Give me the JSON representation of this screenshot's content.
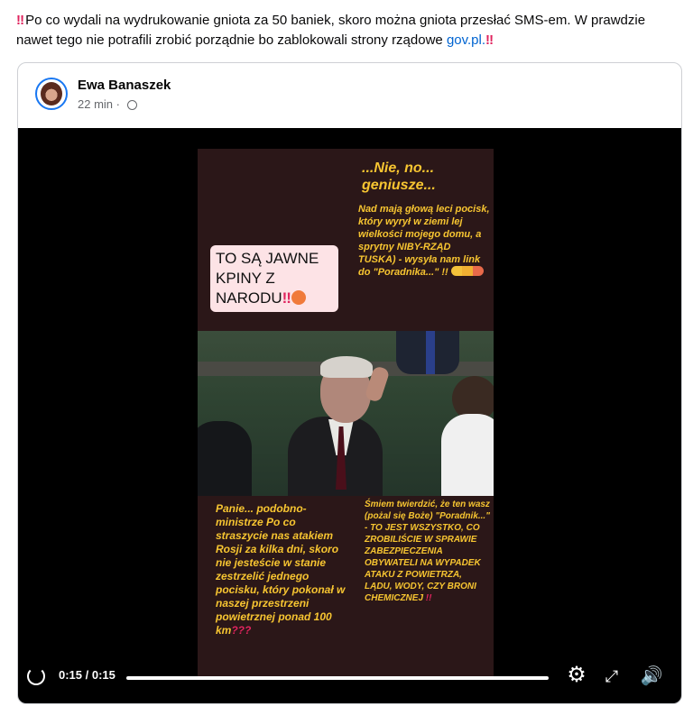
{
  "post": {
    "bang": "‼",
    "text_main": "Po co wydali na wydrukowanie gniota za 50 baniek, skoro można gniota przesłać SMS-em. W prawdzie nawet tego nie potrafili zrobić porządnie bo zablokowali strony rządowe ",
    "link": "gov.pl.",
    "bang_end": "‼"
  },
  "shared": {
    "author": "Ewa Banaszek",
    "time": "22 min",
    "dot": "·",
    "icon": "globe-icon"
  },
  "video": {
    "top_pill": "TO SĄ JAWNE KPINY Z NARODU",
    "top_pill_bangs": "‼",
    "top_right_title": "...Nie, no... geniusze...",
    "top_right_body": "Nad mają głową leci pocisk, który wyrył w ziemi lej wielkości mojego domu, a sprytny NIBY-RZĄD TUSKA) - wysyła nam link do \"Poradnika...\" !!",
    "bottom_left": "Panie... podobno-ministrze Po co straszycie nas atakiem Rosji za kilka dni, skoro nie jesteście w stanie zestrzelić jednego pocisku, który pokonał w naszej przestrzeni powietrznej ponad 100 km",
    "bottom_left_red": "???",
    "bottom_right": "Śmiem twierdzić, że ten wasz (pożal się Boże) \"Poradnik...\" - TO JEST WSZYSTKO, CO ZROBILIŚCIE W SPRAWIE ZABEZPIECZENIA OBYWATELI NA WYPADEK ATAKU Z POWIETRZA, LĄDU, WODY, CZY BRONI CHEMICZNEJ",
    "bottom_right_red": "!!",
    "progress": 1.0
  },
  "controls": {
    "time": "0:15 / 0:15",
    "gear_icon": "⚙",
    "expand_icon": "⤢",
    "volume_icon": "🔊"
  }
}
